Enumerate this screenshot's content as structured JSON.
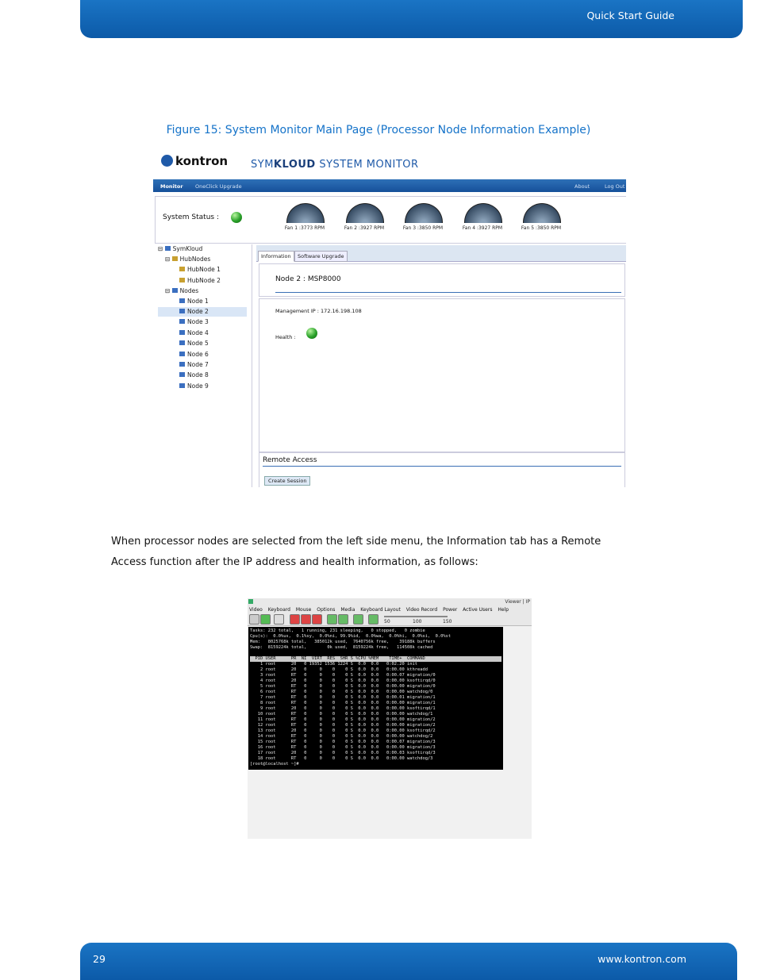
{
  "header": {
    "title": "Quick Start Guide"
  },
  "footer": {
    "page_number": "29",
    "url": "www.kontron.com"
  },
  "caption": "Figure 15: System Monitor Main Page (Processor Node Information Example)",
  "paragraph": "When processor nodes are selected from the left side menu, the Information tab has a Remote Access function after the IP address and health information, as follows:",
  "monitor": {
    "logo": "kontron",
    "title_pre": "SYM",
    "title_bold": "KLOUD",
    "title_post": "SYSTEM MONITOR",
    "nav": {
      "monitor": "Monitor",
      "oneclick": "OneClick Upgrade",
      "about": "About",
      "logout": "Log Out"
    },
    "status_label": "System Status :",
    "fans": [
      "Fan 1 :3773 RPM",
      "Fan 2 :3927 RPM",
      "Fan 3 :3850 RPM",
      "Fan 4 :3927 RPM",
      "Fan 5 :3850 RPM"
    ],
    "tree": {
      "root": "SymKloud",
      "hubnodes": "HubNodes",
      "hubs": [
        "HubNode 1",
        "HubNode 2"
      ],
      "nodes": "Nodes",
      "node_items": [
        "Node 1",
        "Node 2",
        "Node 3",
        "Node 4",
        "Node 5",
        "Node 6",
        "Node 7",
        "Node 8",
        "Node 9"
      ]
    },
    "tabs": {
      "information": "Information",
      "software_upgrade": "Software Upgrade"
    },
    "node_title": "Node 2 : MSP8000",
    "mgmt_ip": "Management IP : 172.16.198.108",
    "health_label": "Health :",
    "remote_access": "Remote Access",
    "create_session": "Create Session"
  },
  "console": {
    "window_title": "Viewer | IP",
    "menu": [
      "Video",
      "Keyboard",
      "Mouse",
      "Options",
      "Media",
      "Keyboard Layout",
      "Video Record",
      "Power",
      "Active Users",
      "Help"
    ],
    "zoom_ticks": [
      "50",
      "100",
      "150"
    ],
    "lines": [
      "Tasks: 232 total,   1 running, 231 sleeping,   0 stopped,   0 zombie",
      "Cpu(s):  0.0%us,  0.1%sy,  0.0%ni, 99.9%id,  0.0%wa,  0.0%hi,  0.0%si,  0.0%st",
      "Mem:   8025768k total,   385012k used,  7640756k free,    39188k buffers",
      "Swap:  8159224k total,        0k used,  8159224k free,   114508k cached",
      "",
      "  PID USER      PR  NI  VIRT  RES  SHR S %CPU %MEM    TIME+  COMMAND",
      "    1 root      20   0 19352 1536 1224 S  0.0  0.0   0:02.20 init",
      "    2 root      20   0     0    0    0 S  0.0  0.0   0:00.00 kthreadd",
      "    3 root      RT   0     0    0    0 S  0.0  0.0   0:00.07 migration/0",
      "    4 root      20   0     0    0    0 S  0.0  0.0   0:00.00 ksoftirqd/0",
      "    5 root      RT   0     0    0    0 S  0.0  0.0   0:00.00 migration/0",
      "    6 root      RT   0     0    0    0 S  0.0  0.0   0:00.00 watchdog/0",
      "    7 root      RT   0     0    0    0 S  0.0  0.0   0:00.01 migration/1",
      "    8 root      RT   0     0    0    0 S  0.0  0.0   0:00.00 migration/1",
      "    9 root      20   0     0    0    0 S  0.0  0.0   0:00.00 ksoftirqd/1",
      "   10 root      RT   0     0    0    0 S  0.0  0.0   0:00.00 watchdog/1",
      "   11 root      RT   0     0    0    0 S  0.0  0.0   0:00.00 migration/2",
      "   12 root      RT   0     0    0    0 S  0.0  0.0   0:00.00 migration/2",
      "   13 root      20   0     0    0    0 S  0.0  0.0   0:00.00 ksoftirqd/2",
      "   14 root      RT   0     0    0    0 S  0.0  0.0   0:00.00 watchdog/2",
      "   15 root      RT   0     0    0    0 S  0.0  0.0   0:00.07 migration/3",
      "   16 root      RT   0     0    0    0 S  0.0  0.0   0:00.00 migration/3",
      "   17 root      20   0     0    0    0 S  0.0  0.0   0:00.03 ksoftirqd/3",
      "   18 root      RT   0     0    0    0 S  0.0  0.0   0:00.00 watchdog/3",
      "[root@localhost ~]#"
    ]
  }
}
